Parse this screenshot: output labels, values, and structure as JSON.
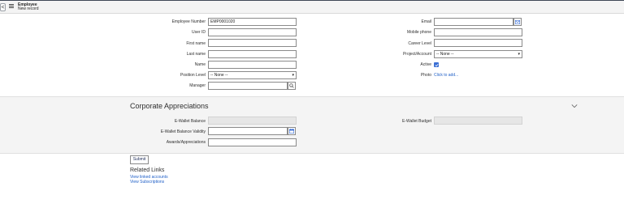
{
  "header": {
    "back_label": "<",
    "title": "Employee",
    "subtitle": "New record"
  },
  "form_left": {
    "employee_number": {
      "label": "Employee Number",
      "value": "EMP0001020"
    },
    "user_id": {
      "label": "User ID",
      "value": ""
    },
    "first_name": {
      "label": "First name",
      "value": ""
    },
    "last_name": {
      "label": "Last name",
      "value": ""
    },
    "name": {
      "label": "Name",
      "value": ""
    },
    "position_level": {
      "label": "Position Level",
      "value": "-- None --"
    },
    "manager": {
      "label": "Manager",
      "value": ""
    }
  },
  "form_right": {
    "email": {
      "label": "Email",
      "value": ""
    },
    "mobile_phone": {
      "label": "Mobile phone",
      "value": ""
    },
    "career_level": {
      "label": "Career Level",
      "value": ""
    },
    "project_account": {
      "label": "Project/Account",
      "value": "-- None --"
    },
    "active": {
      "label": "Active",
      "checked": true
    },
    "photo": {
      "label": "Photo",
      "link": "Click to add..."
    }
  },
  "appreciations": {
    "title": "Corporate Appreciations",
    "wallet_balance": {
      "label": "E-Wallet Balance",
      "value": ""
    },
    "wallet_validity": {
      "label": "E-Wallet Balance Validity",
      "value": ""
    },
    "awards": {
      "label": "Awards/Appreciations",
      "value": ""
    },
    "wallet_budget": {
      "label": "E-Wallet Budget",
      "value": ""
    }
  },
  "actions": {
    "submit_label": "Submit"
  },
  "related": {
    "title": "Related Links",
    "links": [
      "View linked accounts",
      "View Subscriptions"
    ]
  },
  "colors": {
    "accent": "#3b6fd4",
    "link": "#1f5fc7",
    "header_bg": "#f4f4f4"
  },
  "icons": [
    "chevron-left-icon",
    "menu-icon",
    "email-icon",
    "search-icon",
    "calendar-icon",
    "checkmark-icon",
    "chevron-down-icon"
  ]
}
